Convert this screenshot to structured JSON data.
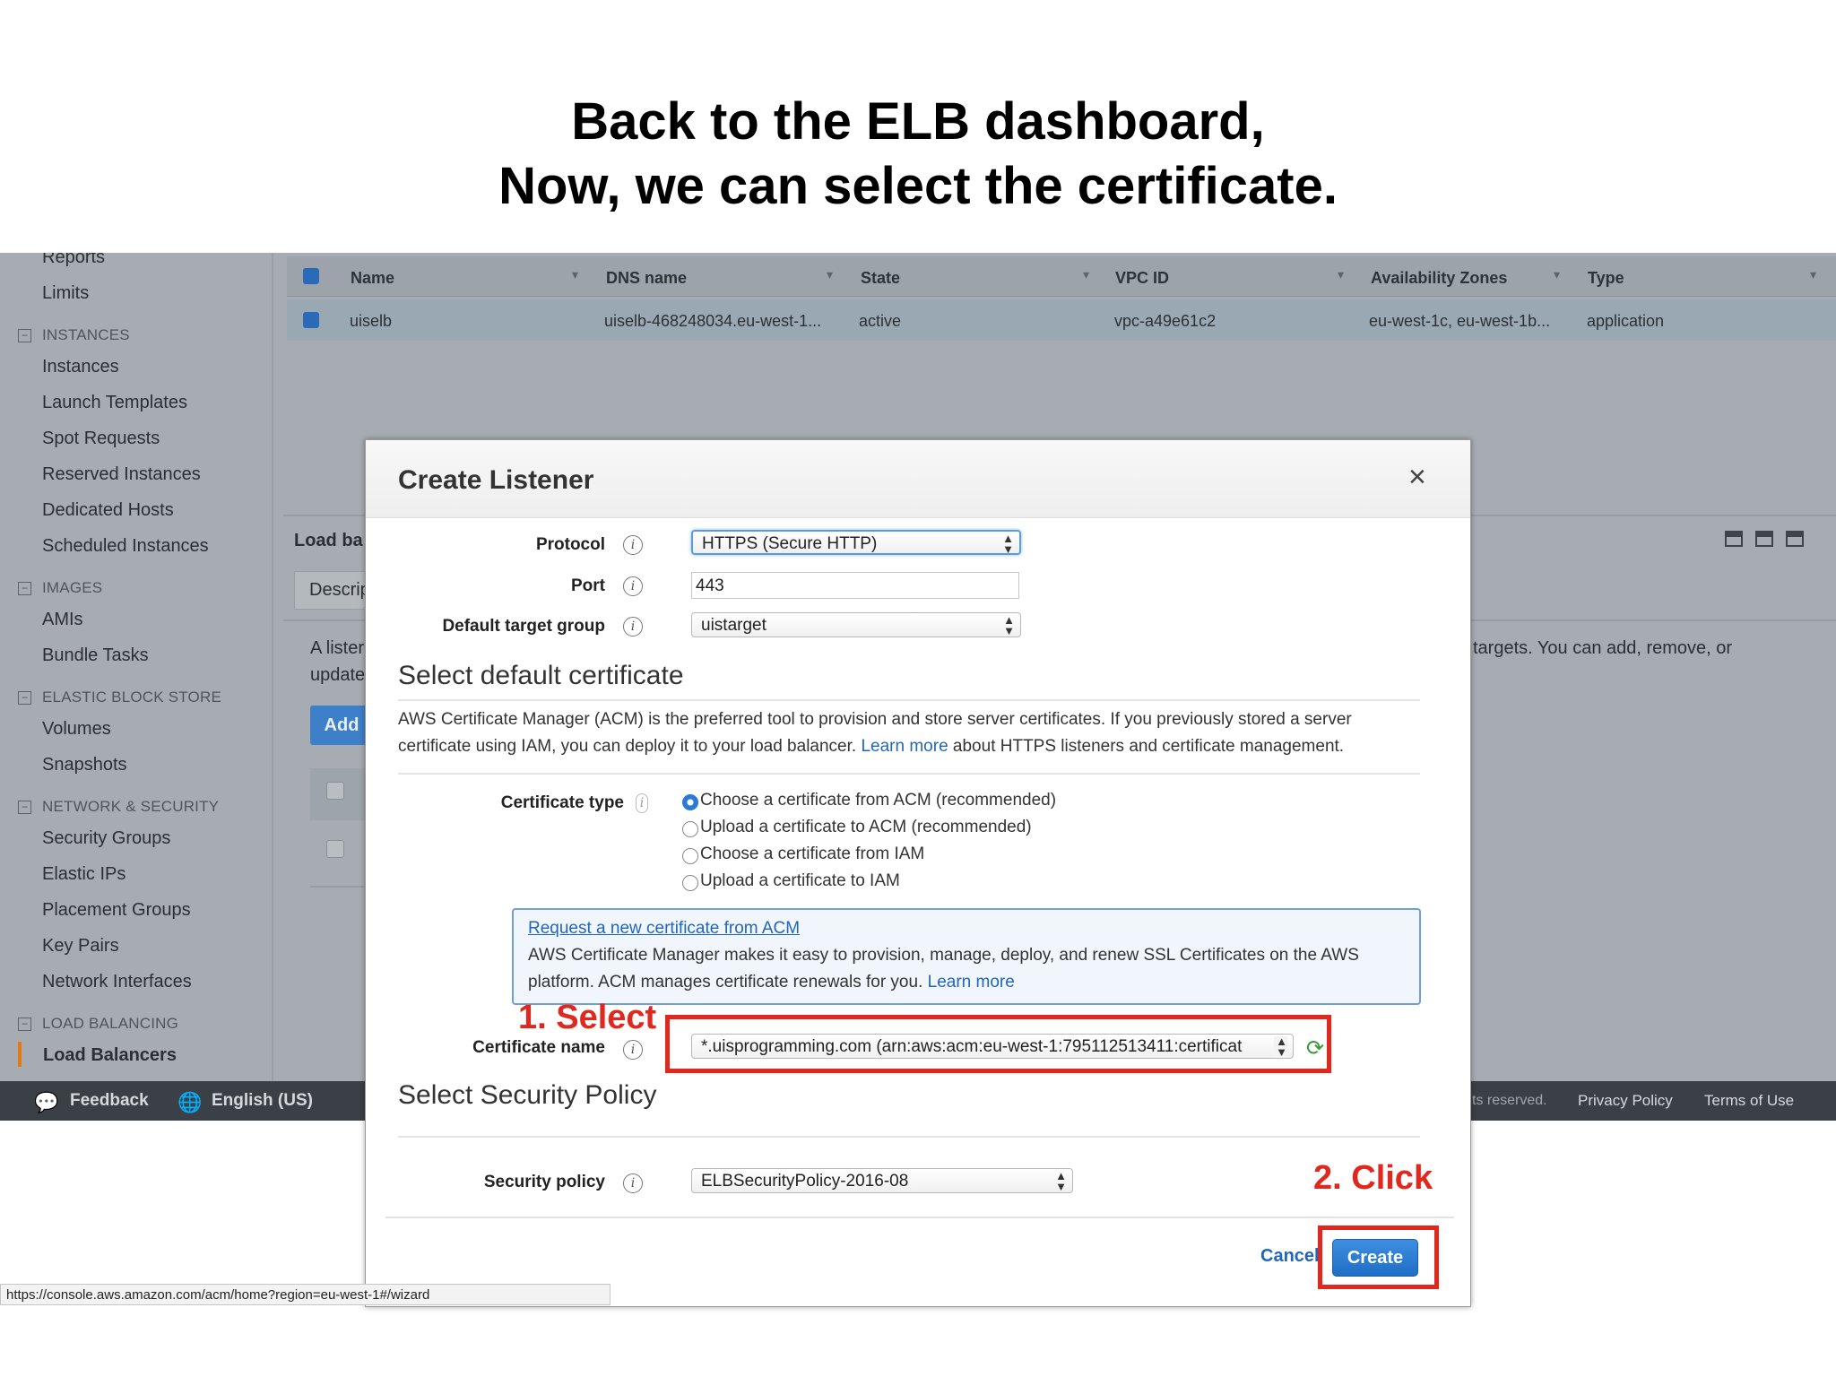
{
  "slide": {
    "title_line1": "Back to the ELB dashboard,",
    "title_line2": "Now, we can select the certificate."
  },
  "sidebar": {
    "items": [
      {
        "label": "Reports"
      },
      {
        "label": "Limits"
      },
      {
        "section": "INSTANCES"
      },
      {
        "label": "Instances"
      },
      {
        "label": "Launch Templates"
      },
      {
        "label": "Spot Requests"
      },
      {
        "label": "Reserved Instances"
      },
      {
        "label": "Dedicated Hosts"
      },
      {
        "label": "Scheduled Instances"
      },
      {
        "section": "IMAGES"
      },
      {
        "label": "AMIs"
      },
      {
        "label": "Bundle Tasks"
      },
      {
        "section": "ELASTIC BLOCK STORE"
      },
      {
        "label": "Volumes"
      },
      {
        "label": "Snapshots"
      },
      {
        "section": "NETWORK & SECURITY"
      },
      {
        "label": "Security Groups"
      },
      {
        "label": "Elastic IPs"
      },
      {
        "label": "Placement Groups"
      },
      {
        "label": "Key Pairs"
      },
      {
        "label": "Network Interfaces"
      },
      {
        "section": "LOAD BALANCING"
      },
      {
        "label": "Load Balancers"
      }
    ]
  },
  "grid": {
    "columns": [
      "Name",
      "DNS name",
      "State",
      "VPC ID",
      "Availability Zones",
      "Type"
    ],
    "rows": [
      [
        "uiselb",
        "uiselb-468248034.eu-west-1...",
        "active",
        "vpc-a49e61c2",
        "eu-west-1c, eu-west-1b...",
        "application"
      ]
    ]
  },
  "background_panel": {
    "load_label": "Load ba",
    "tab_label": "Descrip",
    "text_line1": "A lister",
    "text_line2": "update",
    "add_label": "Add",
    "right_text": "targets. You can add, remove, or"
  },
  "footer": {
    "feedback": "Feedback",
    "language": "English (US)",
    "rights": "ts reserved.",
    "privacy": "Privacy Policy",
    "terms": "Terms of Use"
  },
  "modal": {
    "title": "Create Listener",
    "close": "×",
    "protocol_label": "Protocol",
    "protocol_value": "HTTPS (Secure HTTP)",
    "port_label": "Port",
    "port_value": "443",
    "target_group_label": "Default target group",
    "target_group_value": "uistarget",
    "cert_section_title": "Select default certificate",
    "cert_desc_line1": "AWS Certificate Manager (ACM) is the preferred tool to provision and store server certificates. If you previously stored a server",
    "cert_desc_line2_a": "certificate using IAM, you can deploy it to your load balancer.",
    "cert_desc_learn_more": "Learn more",
    "cert_desc_line2_b": "about HTTPS listeners and certificate management.",
    "cert_type_label": "Certificate type",
    "cert_type_options": [
      {
        "label": "Choose a certificate from ACM (recommended)",
        "selected": true
      },
      {
        "label": "Upload a certificate to ACM (recommended)",
        "selected": false
      },
      {
        "label": "Choose a certificate from IAM",
        "selected": false
      },
      {
        "label": "Upload a certificate to IAM",
        "selected": false
      }
    ],
    "acm_box": {
      "link": "Request a new certificate from ACM",
      "line1": "AWS Certificate Manager makes it easy to provision, manage, deploy, and renew SSL Certificates on the AWS",
      "line2": "platform. ACM manages certificate renewals for you.",
      "learn_more": "Learn more"
    },
    "cert_name_label": "Certificate name",
    "cert_name_value": "*.uisprogramming.com (arn:aws:acm:eu-west-1:795112513411:certificat",
    "security_section_title": "Select Security Policy",
    "security_policy_label": "Security policy",
    "security_policy_value": "ELBSecurityPolicy-2016-08",
    "cancel": "Cancel",
    "create": "Create"
  },
  "annotations": {
    "step1": "1. Select",
    "step2": "2. Click"
  },
  "status_bar_url": "https://console.aws.amazon.com/acm/home?region=eu-west-1#/wizard",
  "colors": {
    "annotation_red": "#e0281e",
    "primary_blue": "#2b7bd6",
    "link_blue": "#2266bb"
  }
}
